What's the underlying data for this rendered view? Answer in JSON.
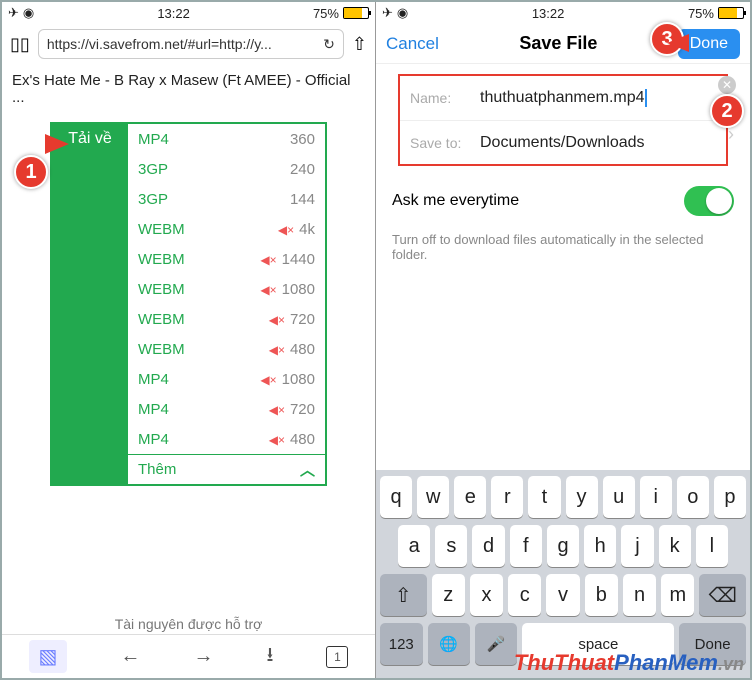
{
  "status": {
    "time": "13:22",
    "battery": "75%"
  },
  "left": {
    "url": "https://vi.savefrom.net/#url=http://y...",
    "page_title": "Ex's Hate Me - B Ray x Masew (Ft AMEE) - Official ...",
    "download_btn": "Tải về",
    "options": [
      {
        "fmt": "MP4",
        "muted": false,
        "q": "360"
      },
      {
        "fmt": "3GP",
        "muted": false,
        "q": "240"
      },
      {
        "fmt": "3GP",
        "muted": false,
        "q": "144"
      },
      {
        "fmt": "WEBM",
        "muted": true,
        "q": "4k"
      },
      {
        "fmt": "WEBM",
        "muted": true,
        "q": "1440"
      },
      {
        "fmt": "WEBM",
        "muted": true,
        "q": "1080"
      },
      {
        "fmt": "WEBM",
        "muted": true,
        "q": "720"
      },
      {
        "fmt": "WEBM",
        "muted": true,
        "q": "480"
      },
      {
        "fmt": "MP4",
        "muted": true,
        "q": "1080"
      },
      {
        "fmt": "MP4",
        "muted": true,
        "q": "720"
      },
      {
        "fmt": "MP4",
        "muted": true,
        "q": "480"
      }
    ],
    "more": "Thêm",
    "support": "Tài nguyên được hỗ trợ",
    "tab_count": "1"
  },
  "right": {
    "cancel": "Cancel",
    "title": "Save File",
    "done": "Done",
    "name_lbl": "Name:",
    "name_val": "thuthuatphanmem.mp4",
    "save_lbl": "Save to:",
    "save_val": "Documents/Downloads",
    "ask": "Ask me everytime",
    "hint": "Turn off to download files automatically in the selected folder.",
    "keys": {
      "r1": [
        "q",
        "w",
        "e",
        "r",
        "t",
        "y",
        "u",
        "i",
        "o",
        "p"
      ],
      "r2": [
        "a",
        "s",
        "d",
        "f",
        "g",
        "h",
        "j",
        "k",
        "l"
      ],
      "r3": [
        "z",
        "x",
        "c",
        "v",
        "b",
        "n",
        "m"
      ],
      "num": "123",
      "space": "space",
      "done": "Done"
    }
  },
  "callouts": {
    "c1": "1",
    "c2": "2",
    "c3": "3"
  },
  "watermark": {
    "a": "ThuThuat",
    "b": "PhanMem",
    "c": ".vn"
  }
}
